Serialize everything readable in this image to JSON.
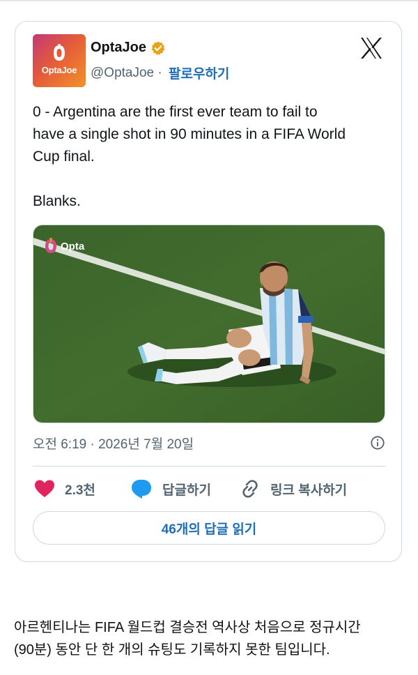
{
  "tweet": {
    "avatar_text": "OptaJoe",
    "display_name": "OptaJoe",
    "handle": "@OptaJoe",
    "separator": " · ",
    "follow_label": "팔로우하기",
    "text": "0 - Argentina are the first ever team to fail to\nhave a single shot in 90 minutes in a FIFA World\nCup final.\n\nBlanks.",
    "media": {
      "watermark": "Opta"
    },
    "timestamp": "오전 6:19 · 2026년 7월 20일",
    "likes": "2.3천",
    "reply_label": "답글하기",
    "copy_link_label": "링크 복사하기",
    "read_replies_label": "46개의 답글 읽기"
  },
  "caption": "아르헨티나는 FIFA 월드컵 결승전 역사상 처음으로 정규시간\n(90분) 동안 단 한 개의 슈팅도 기록하지 못한 팀입니다.",
  "icons": {
    "verified": "verified-badge-icon",
    "x_logo": "x-logo-icon",
    "info": "info-icon",
    "like": "heart-icon",
    "reply": "speech-bubble-icon",
    "link": "link-icon"
  },
  "colors": {
    "like": "#e0245e",
    "reply": "#1d9bf0",
    "link_text": "#1d6fb8",
    "verified": "#e8a317",
    "muted": "#536471",
    "border": "#cfd9de"
  }
}
